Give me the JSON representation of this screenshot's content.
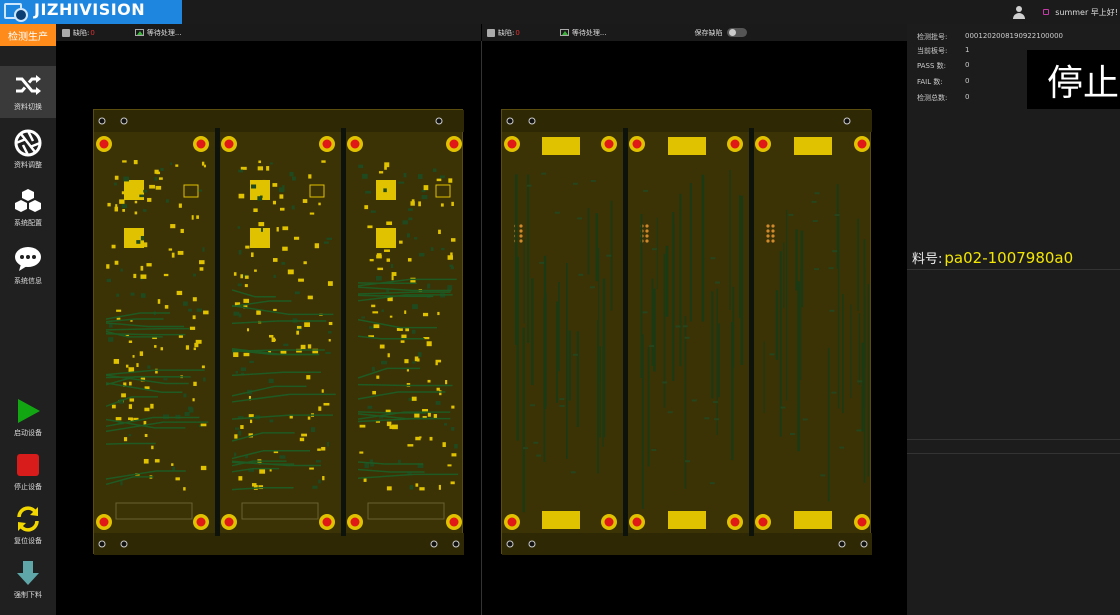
{
  "header": {
    "brand": "JIZHIVISION",
    "user_name": "summer 早上好!"
  },
  "sidebar": {
    "mode_tab": "检测生产",
    "items": [
      {
        "label": "资料切换",
        "icon": "shuffle-icon"
      },
      {
        "label": "资料调整",
        "icon": "aperture-icon"
      },
      {
        "label": "系统配置",
        "icon": "cubes-icon"
      },
      {
        "label": "系统信息",
        "icon": "chat-icon"
      }
    ],
    "controls": [
      {
        "label": "启动设备",
        "icon": "play-icon",
        "color": "#13a613"
      },
      {
        "label": "停止设备",
        "icon": "stop-icon",
        "color": "#d81b1b"
      },
      {
        "label": "复位设备",
        "icon": "reset-icon",
        "color": "#f2d600"
      },
      {
        "label": "强制下料",
        "icon": "download-icon",
        "color": "#5fa6a8"
      }
    ]
  },
  "left_panel": {
    "defect_label": "缺陷:",
    "defect_count": "0",
    "image_label": "等待处理..."
  },
  "right_panel": {
    "defect_label": "缺陷:",
    "defect_count": "0",
    "image_label": "等待处理...",
    "save_label": "保存缺陷"
  },
  "info": {
    "rows": [
      {
        "key": "检测批号:",
        "value": "0001202008190922100000"
      },
      {
        "key": "当前板号:",
        "value": "1"
      },
      {
        "key": "PASS 数:",
        "value": "0"
      },
      {
        "key": "FAIL 数:",
        "value": "0"
      },
      {
        "key": "检测总数:",
        "value": "0"
      }
    ],
    "status": "停止",
    "material_label": "料号:",
    "material_value": "pa02-1007980a0"
  },
  "colors": {
    "board": "#3b3206",
    "copper": "#e0c200",
    "pad_red": "#e01818",
    "accent": "#ff8c1a",
    "brand_bar": "#1f86e0"
  }
}
